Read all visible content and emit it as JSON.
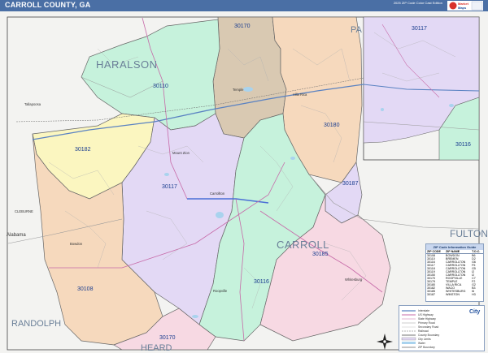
{
  "header": {
    "title": "CARROLL COUNTY, GA",
    "edition": "2025 ZIP Code Color Cast Edition",
    "logo_text": "Market Maps"
  },
  "colors": {
    "header_bg": "#4a6fa5",
    "zip_30110": "#c6f2dc",
    "zip_30170": "#d9c9b2",
    "zip_30180": "#f6d9bd",
    "zip_30182": "#fbf6c0",
    "zip_30117": "#e3d9f5",
    "zip_30116": "#c6f2dc",
    "zip_30185": "#f7d9e3",
    "zip_30108": "#f6d9bd",
    "zip_30187": "#e3d9f5",
    "water": "#a9d3ee"
  },
  "map": {
    "county_labels": [
      {
        "name": "HARALSON"
      },
      {
        "name": "CARROLL"
      },
      {
        "name": "FULTON"
      },
      {
        "name": "RANDOLPH"
      },
      {
        "name": "HEARD"
      },
      {
        "name": "PA"
      }
    ],
    "zip_labels": [
      "30170",
      "30110",
      "30180",
      "30182",
      "30117",
      "30187",
      "30185",
      "30108",
      "30116",
      "30170"
    ],
    "inset_zip_labels": [
      "30117",
      "30116"
    ],
    "place_labels": [
      "Alabama",
      "CLEBURNE",
      "Tallapoosa",
      "Villa Rica",
      "Temple",
      "Carrollton",
      "Bowdon",
      "Whitesburg",
      "Roopville",
      "Mount Zion"
    ]
  },
  "legend": {
    "title": "ZIP Code Information Guide",
    "columns": [
      "ZIP CODE",
      "ZIP NAME",
      "T.O.C."
    ],
    "rows": [
      [
        "30108",
        "BOWDON",
        "B6"
      ],
      [
        "30110",
        "BREMEN",
        "D2"
      ],
      [
        "30116",
        "CARROLLTON",
        "G6"
      ],
      [
        "30117",
        "CARROLLTON",
        "F5"
      ],
      [
        "30118",
        "CARROLLTON",
        "G5"
      ],
      [
        "30119",
        "CARROLLTON",
        "I2"
      ],
      [
        "30150",
        "CARROLLTON",
        "I2"
      ],
      [
        "30170",
        "ROOPVILLE",
        "C7"
      ],
      [
        "30179",
        "TEMPLE",
        "F2"
      ],
      [
        "30180",
        "VILLA RICA",
        "G2"
      ],
      [
        "30182",
        "WACO",
        "B3"
      ],
      [
        "30185",
        "WHITESBURG",
        "I6"
      ],
      [
        "30187",
        "WINSTON",
        "H3"
      ]
    ]
  },
  "key": {
    "brand": "City",
    "items": [
      "Interstate",
      "US Highway",
      "State Highway",
      "Primary Road",
      "Secondary Road",
      "Railroad",
      "County Boundary",
      "City Limits",
      "Water",
      "ZIP Boundary"
    ],
    "north_label": "N"
  }
}
